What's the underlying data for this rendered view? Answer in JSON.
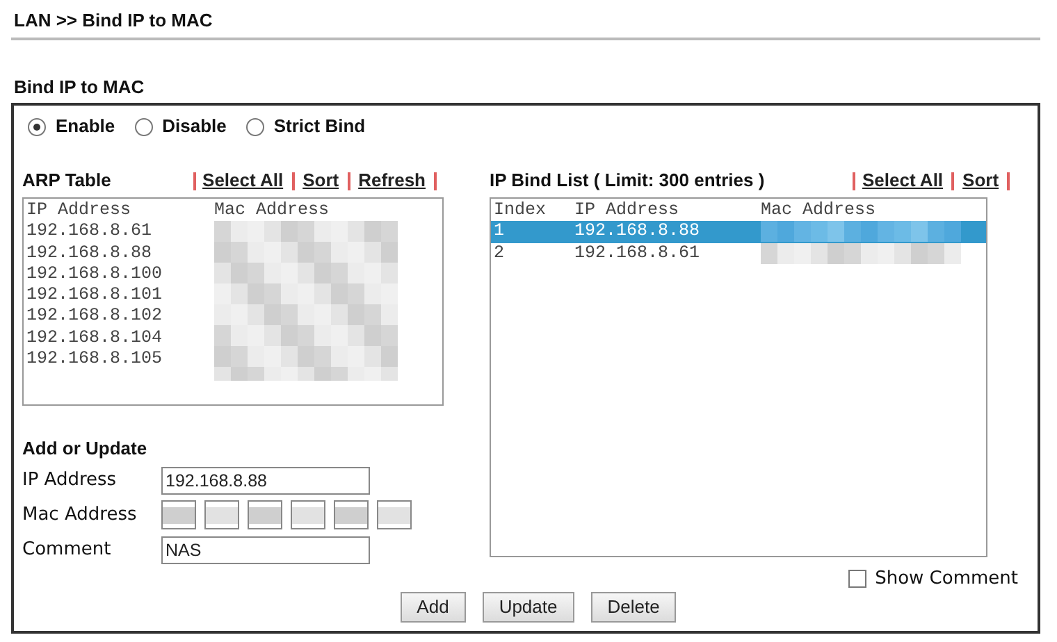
{
  "breadcrumb": "LAN >> Bind IP to MAC",
  "section_title": "Bind IP to MAC",
  "modes": [
    {
      "label": "Enable",
      "selected": true
    },
    {
      "label": "Disable",
      "selected": false
    },
    {
      "label": "Strict Bind",
      "selected": false
    }
  ],
  "arp_table": {
    "title": "ARP Table",
    "links": [
      "Select All",
      "Sort",
      "Refresh"
    ],
    "columns": [
      "IP Address",
      "Mac Address"
    ],
    "rows": [
      {
        "ip": "192.168.8.61"
      },
      {
        "ip": "192.168.8.88"
      },
      {
        "ip": "192.168.8.100"
      },
      {
        "ip": "192.168.8.101"
      },
      {
        "ip": "192.168.8.102"
      },
      {
        "ip": "192.168.8.104"
      },
      {
        "ip": "192.168.8.105"
      }
    ]
  },
  "bind_list": {
    "title": "IP Bind List ( Limit: 300 entries )",
    "links": [
      "Select All",
      "Sort"
    ],
    "columns": [
      "Index",
      "IP Address",
      "Mac Address"
    ],
    "rows": [
      {
        "index": "1",
        "ip": "192.168.8.88",
        "selected": true
      },
      {
        "index": "2",
        "ip": "192.168.8.61",
        "selected": false
      }
    ]
  },
  "form": {
    "title": "Add or Update",
    "fields": [
      {
        "kind": "text",
        "label": "IP Address",
        "value": "192.168.8.88"
      },
      {
        "kind": "mac",
        "label": "Mac Address"
      },
      {
        "kind": "text",
        "label": "Comment",
        "value": "NAS"
      }
    ]
  },
  "show_comment": {
    "label": "Show Comment",
    "checked": false
  },
  "buttons": [
    "Add",
    "Update",
    "Delete"
  ]
}
